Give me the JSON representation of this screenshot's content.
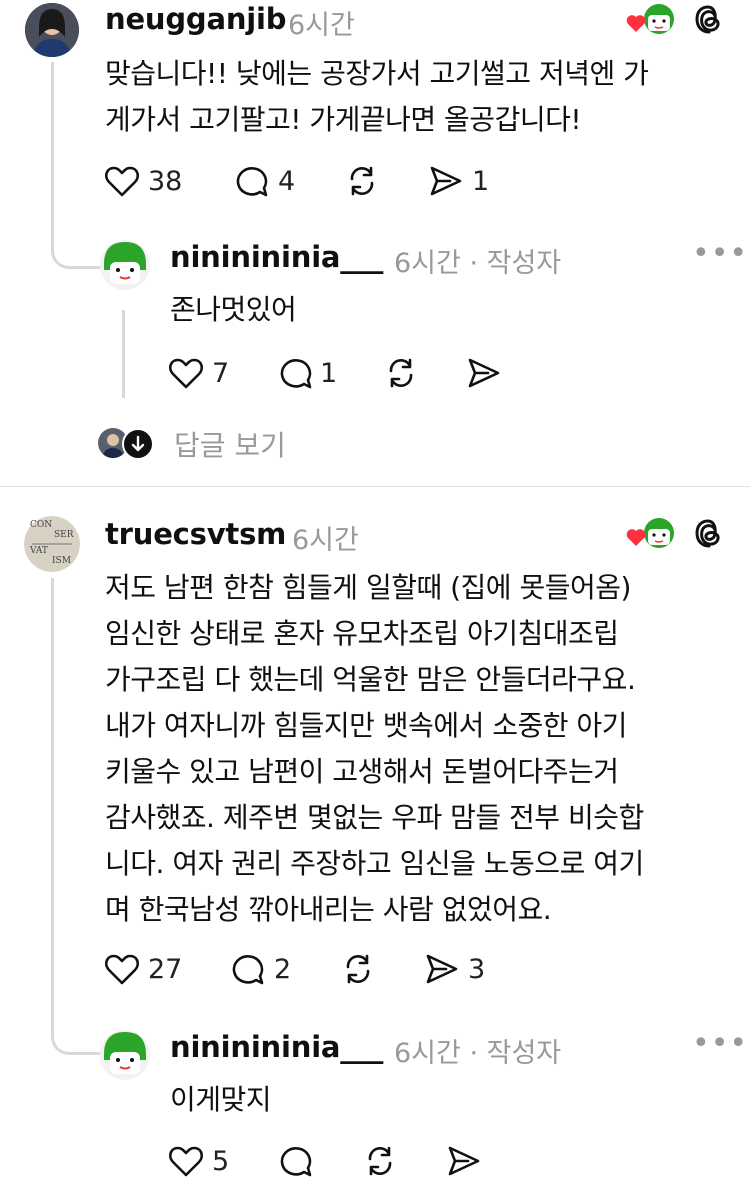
{
  "comment1": {
    "username": "neugganjib",
    "time": "6시간",
    "text_line1": "맞습니다!! 낮에는 공장가서 고기썰고 저녁엔 가",
    "text_line2": "게가서 고기팔고! 가게끝나면 올공갑니다!",
    "likes": "38",
    "replies": "4",
    "shares": "1"
  },
  "reply1": {
    "username": "nininininia___",
    "meta": "6시간 · 작성자",
    "text": "존나멋있어",
    "likes": "7",
    "replies": "1"
  },
  "view_replies_label": "답글 보기",
  "comment2": {
    "username": "truecsvtsm",
    "time": "6시간",
    "avatar_text": [
      "CON",
      "SER",
      "VAT",
      "ISM"
    ],
    "lines": [
      "저도 남편 한참 힘들게 일할때 (집에 못들어옴)",
      "임신한 상태로 혼자 유모차조립 아기침대조립",
      "가구조립 다 했는데 억울한 맘은 안들더라구요.",
      "내가 여자니까 힘들지만 뱃속에서 소중한 아기",
      "키울수 있고 남편이 고생해서 돈벌어다주는거",
      "감사했죠. 제주변 몇없는 우파 맘들 전부 비슷합",
      "니다. 여자 권리 주장하고 임신을 노동으로 여기",
      "며 한국남성 깎아내리는 사람 없었어요."
    ],
    "likes": "27",
    "replies": "2",
    "shares": "3"
  },
  "reply2": {
    "username": "nininininia___",
    "meta": "6시간 · 작성자",
    "text": "이게맞지",
    "likes": "5"
  },
  "colors": {
    "text": "#101010",
    "muted": "#999999",
    "line": "#d9d9d9",
    "heart": "#ff3040",
    "avatar_green": "#2aa52a"
  },
  "icons": [
    "heart-icon",
    "comment-icon",
    "repost-icon",
    "share-icon",
    "threads-logo-icon",
    "more-icon",
    "arrow-down-icon"
  ]
}
